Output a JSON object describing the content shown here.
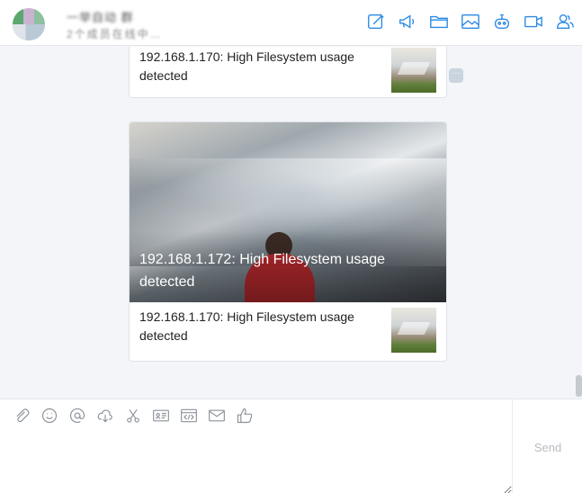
{
  "header": {
    "chat_name": "一举自动 群",
    "chat_tag": "群",
    "chat_subtitle": "2个成员在线中…",
    "toolbar": [
      {
        "name": "edit-icon"
      },
      {
        "name": "announcement-icon"
      },
      {
        "name": "folder-icon"
      },
      {
        "name": "image-icon"
      },
      {
        "name": "robot-icon"
      },
      {
        "name": "video-call-icon"
      },
      {
        "name": "members-icon"
      }
    ]
  },
  "messages": {
    "first_card": {
      "item_text": "192.168.1.170: High Filesystem usage detected"
    },
    "more_label": "···",
    "second_card": {
      "cover_title": "192.168.1.172: High Filesystem usage detected",
      "item_text": "192.168.1.170: High Filesystem usage detected"
    }
  },
  "composer": {
    "tools": [
      {
        "name": "attachment-icon"
      },
      {
        "name": "emoji-icon"
      },
      {
        "name": "mention-icon"
      },
      {
        "name": "cloud-download-icon"
      },
      {
        "name": "scissors-icon"
      },
      {
        "name": "contact-card-icon"
      },
      {
        "name": "code-snippet-icon"
      },
      {
        "name": "mail-icon"
      },
      {
        "name": "thumbs-up-icon"
      }
    ],
    "send_label": "Send",
    "input_placeholder": ""
  },
  "colors": {
    "accent": "#2a8ae6",
    "background": "#f3f5f8",
    "muted_icon": "#8c9299"
  }
}
